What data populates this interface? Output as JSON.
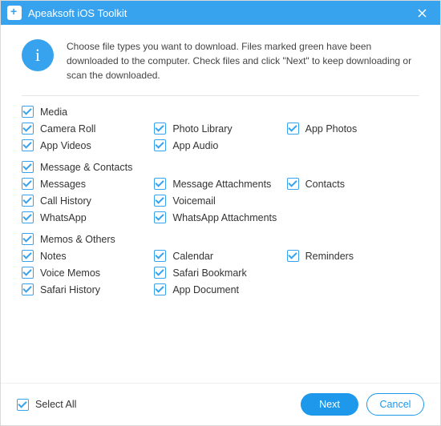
{
  "titlebar": {
    "title": "Apeaksoft iOS Toolkit"
  },
  "intro": {
    "text": "Choose file types you want to download. Files marked green have been downloaded to the computer. Check files and click \"Next\" to keep downloading or scan the downloaded."
  },
  "sections": [
    {
      "header": {
        "label": "Media",
        "checked": true
      },
      "rows": [
        [
          {
            "label": "Camera Roll",
            "checked": true
          },
          {
            "label": "Photo Library",
            "checked": true
          },
          {
            "label": "App Photos",
            "checked": true
          }
        ],
        [
          {
            "label": "App Videos",
            "checked": true
          },
          {
            "label": "App Audio",
            "checked": true
          }
        ]
      ]
    },
    {
      "header": {
        "label": "Message & Contacts",
        "checked": true
      },
      "rows": [
        [
          {
            "label": "Messages",
            "checked": true
          },
          {
            "label": "Message Attachments",
            "checked": true
          },
          {
            "label": "Contacts",
            "checked": true
          }
        ],
        [
          {
            "label": "Call History",
            "checked": true
          },
          {
            "label": "Voicemail",
            "checked": true
          }
        ],
        [
          {
            "label": "WhatsApp",
            "checked": true
          },
          {
            "label": "WhatsApp Attachments",
            "checked": true
          }
        ]
      ]
    },
    {
      "header": {
        "label": "Memos & Others",
        "checked": true
      },
      "rows": [
        [
          {
            "label": "Notes",
            "checked": true
          },
          {
            "label": "Calendar",
            "checked": true
          },
          {
            "label": "Reminders",
            "checked": true
          }
        ],
        [
          {
            "label": "Voice Memos",
            "checked": true
          },
          {
            "label": "Safari Bookmark",
            "checked": true
          }
        ],
        [
          {
            "label": "Safari History",
            "checked": true
          },
          {
            "label": "App Document",
            "checked": true
          }
        ]
      ]
    }
  ],
  "footer": {
    "select_all": {
      "label": "Select All",
      "checked": true
    },
    "next_label": "Next",
    "cancel_label": "Cancel"
  }
}
